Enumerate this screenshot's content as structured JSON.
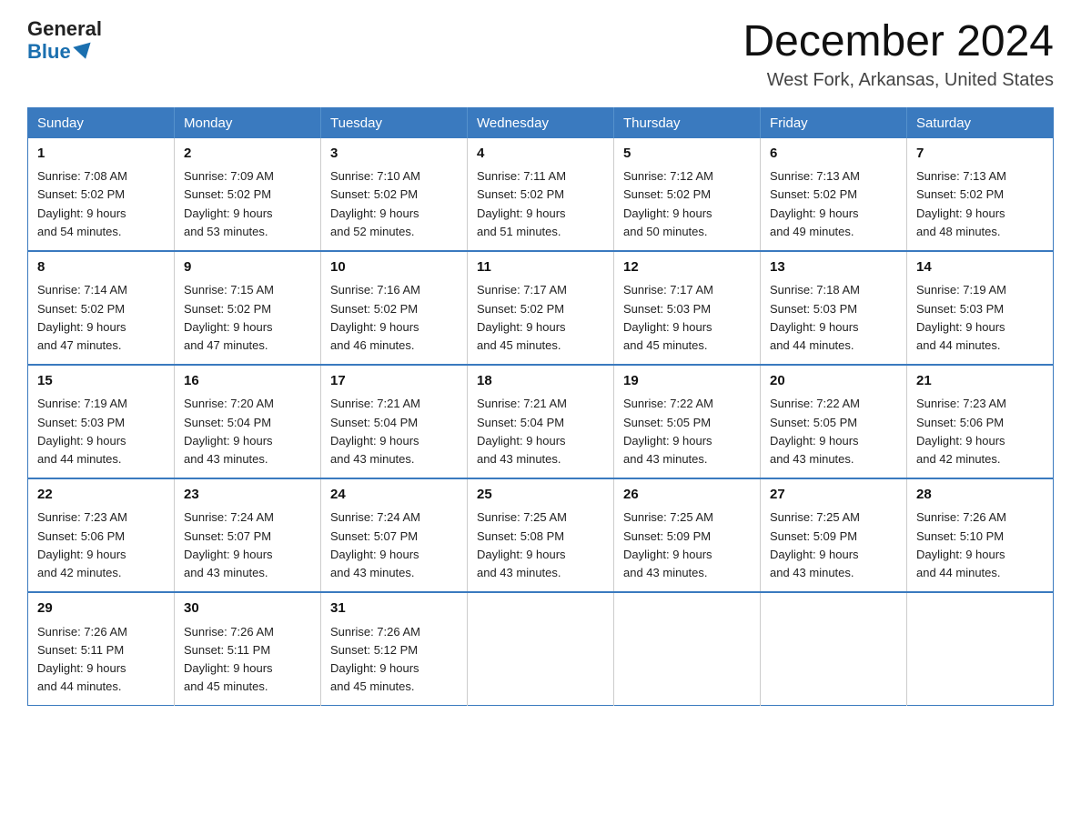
{
  "logo": {
    "general": "General",
    "blue": "Blue"
  },
  "header": {
    "title": "December 2024",
    "location": "West Fork, Arkansas, United States"
  },
  "weekdays": [
    "Sunday",
    "Monday",
    "Tuesday",
    "Wednesday",
    "Thursday",
    "Friday",
    "Saturday"
  ],
  "weeks": [
    [
      {
        "day": "1",
        "sunrise": "7:08 AM",
        "sunset": "5:02 PM",
        "daylight": "9 hours and 54 minutes."
      },
      {
        "day": "2",
        "sunrise": "7:09 AM",
        "sunset": "5:02 PM",
        "daylight": "9 hours and 53 minutes."
      },
      {
        "day": "3",
        "sunrise": "7:10 AM",
        "sunset": "5:02 PM",
        "daylight": "9 hours and 52 minutes."
      },
      {
        "day": "4",
        "sunrise": "7:11 AM",
        "sunset": "5:02 PM",
        "daylight": "9 hours and 51 minutes."
      },
      {
        "day": "5",
        "sunrise": "7:12 AM",
        "sunset": "5:02 PM",
        "daylight": "9 hours and 50 minutes."
      },
      {
        "day": "6",
        "sunrise": "7:13 AM",
        "sunset": "5:02 PM",
        "daylight": "9 hours and 49 minutes."
      },
      {
        "day": "7",
        "sunrise": "7:13 AM",
        "sunset": "5:02 PM",
        "daylight": "9 hours and 48 minutes."
      }
    ],
    [
      {
        "day": "8",
        "sunrise": "7:14 AM",
        "sunset": "5:02 PM",
        "daylight": "9 hours and 47 minutes."
      },
      {
        "day": "9",
        "sunrise": "7:15 AM",
        "sunset": "5:02 PM",
        "daylight": "9 hours and 47 minutes."
      },
      {
        "day": "10",
        "sunrise": "7:16 AM",
        "sunset": "5:02 PM",
        "daylight": "9 hours and 46 minutes."
      },
      {
        "day": "11",
        "sunrise": "7:17 AM",
        "sunset": "5:02 PM",
        "daylight": "9 hours and 45 minutes."
      },
      {
        "day": "12",
        "sunrise": "7:17 AM",
        "sunset": "5:03 PM",
        "daylight": "9 hours and 45 minutes."
      },
      {
        "day": "13",
        "sunrise": "7:18 AM",
        "sunset": "5:03 PM",
        "daylight": "9 hours and 44 minutes."
      },
      {
        "day": "14",
        "sunrise": "7:19 AM",
        "sunset": "5:03 PM",
        "daylight": "9 hours and 44 minutes."
      }
    ],
    [
      {
        "day": "15",
        "sunrise": "7:19 AM",
        "sunset": "5:03 PM",
        "daylight": "9 hours and 44 minutes."
      },
      {
        "day": "16",
        "sunrise": "7:20 AM",
        "sunset": "5:04 PM",
        "daylight": "9 hours and 43 minutes."
      },
      {
        "day": "17",
        "sunrise": "7:21 AM",
        "sunset": "5:04 PM",
        "daylight": "9 hours and 43 minutes."
      },
      {
        "day": "18",
        "sunrise": "7:21 AM",
        "sunset": "5:04 PM",
        "daylight": "9 hours and 43 minutes."
      },
      {
        "day": "19",
        "sunrise": "7:22 AM",
        "sunset": "5:05 PM",
        "daylight": "9 hours and 43 minutes."
      },
      {
        "day": "20",
        "sunrise": "7:22 AM",
        "sunset": "5:05 PM",
        "daylight": "9 hours and 43 minutes."
      },
      {
        "day": "21",
        "sunrise": "7:23 AM",
        "sunset": "5:06 PM",
        "daylight": "9 hours and 42 minutes."
      }
    ],
    [
      {
        "day": "22",
        "sunrise": "7:23 AM",
        "sunset": "5:06 PM",
        "daylight": "9 hours and 42 minutes."
      },
      {
        "day": "23",
        "sunrise": "7:24 AM",
        "sunset": "5:07 PM",
        "daylight": "9 hours and 43 minutes."
      },
      {
        "day": "24",
        "sunrise": "7:24 AM",
        "sunset": "5:07 PM",
        "daylight": "9 hours and 43 minutes."
      },
      {
        "day": "25",
        "sunrise": "7:25 AM",
        "sunset": "5:08 PM",
        "daylight": "9 hours and 43 minutes."
      },
      {
        "day": "26",
        "sunrise": "7:25 AM",
        "sunset": "5:09 PM",
        "daylight": "9 hours and 43 minutes."
      },
      {
        "day": "27",
        "sunrise": "7:25 AM",
        "sunset": "5:09 PM",
        "daylight": "9 hours and 43 minutes."
      },
      {
        "day": "28",
        "sunrise": "7:26 AM",
        "sunset": "5:10 PM",
        "daylight": "9 hours and 44 minutes."
      }
    ],
    [
      {
        "day": "29",
        "sunrise": "7:26 AM",
        "sunset": "5:11 PM",
        "daylight": "9 hours and 44 minutes."
      },
      {
        "day": "30",
        "sunrise": "7:26 AM",
        "sunset": "5:11 PM",
        "daylight": "9 hours and 45 minutes."
      },
      {
        "day": "31",
        "sunrise": "7:26 AM",
        "sunset": "5:12 PM",
        "daylight": "9 hours and 45 minutes."
      },
      null,
      null,
      null,
      null
    ]
  ],
  "labels": {
    "sunrise": "Sunrise:",
    "sunset": "Sunset:",
    "daylight": "Daylight:"
  }
}
